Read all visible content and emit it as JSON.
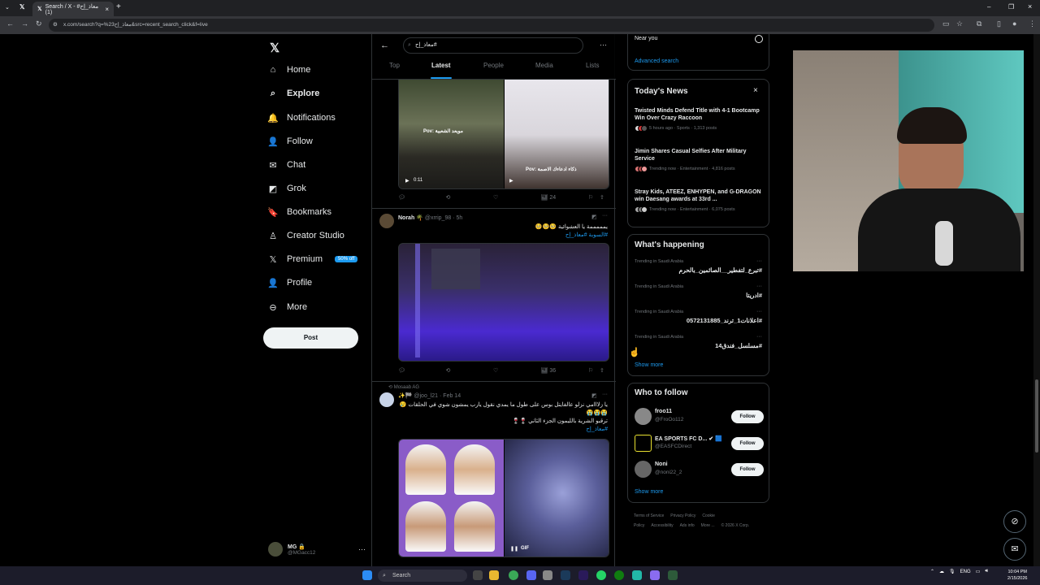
{
  "browser": {
    "tab_title": "Search / X - معاذ_إح# (1)",
    "url": "x.com/search?q=%23معاذ_إح&src=recent_search_click&f=live"
  },
  "sidebar": {
    "items": [
      {
        "label": "Home",
        "icon": "home-icon",
        "glyph": "⌂"
      },
      {
        "label": "Explore",
        "icon": "search-icon",
        "glyph": "⌕"
      },
      {
        "label": "Notifications",
        "icon": "bell-icon",
        "glyph": "🔔"
      },
      {
        "label": "Follow",
        "icon": "person-plus-icon",
        "glyph": "👤"
      },
      {
        "label": "Chat",
        "icon": "mail-icon",
        "glyph": "✉"
      },
      {
        "label": "Grok",
        "icon": "grok-icon",
        "glyph": "◩"
      },
      {
        "label": "Bookmarks",
        "icon": "bookmark-icon",
        "glyph": "🔖"
      },
      {
        "label": "Creator Studio",
        "icon": "creator-icon",
        "glyph": "♙"
      },
      {
        "label": "Premium",
        "icon": "x-premium-icon",
        "glyph": "𝕏"
      },
      {
        "label": "Profile",
        "icon": "profile-icon",
        "glyph": "👤"
      },
      {
        "label": "More",
        "icon": "more-circle-icon",
        "glyph": "⊖"
      }
    ],
    "premium_badge": "50% off",
    "post_button": "Post",
    "account": {
      "name": "MG 🔒",
      "handle": "@MGacc12"
    }
  },
  "search": {
    "query": "معاذ_إح#",
    "tabs": [
      "Top",
      "Latest",
      "People",
      "Media",
      "Lists"
    ],
    "active_tab": "Latest"
  },
  "feed": {
    "post0": {
      "video_time": "0:11",
      "caption_left": "Pov: مويعد الشعبية",
      "caption_right": "Pov: ذكاء ادعاءك الاصمة",
      "views": "24"
    },
    "post1": {
      "author": "Norah 🌴",
      "handle": "@xrrip_98 · 5h",
      "text": "يمممممة يا العشوائية 🥺🥺🥺",
      "hashtags": "#السوبة #معاذ_إح",
      "views": "36"
    },
    "post2": {
      "reposted_by": "Mosaab AG",
      "handle": "@joo_l21 · Feb 14",
      "emoji": "✨🏁",
      "text": "يا زلااامي نزلو عالفايتل بوس على طول ما يمدي نقول يارب يمشون شوي في الحلقات 😢",
      "text2": "😭😭😭",
      "text3": "ترقبو الشرية بالليمون الجزء الثاني 🍷🍷",
      "hashtags": "#معاذ_إح",
      "gif": "GIF"
    }
  },
  "right": {
    "near_you": "Near you",
    "advanced_search": "Advanced search",
    "todays_news": {
      "title": "Today's News",
      "items": [
        {
          "title": "Twisted Minds Defend Title with 4-1 Bootcamp Win Over Crazy Raccoon",
          "meta": "5 hours ago · Sports · 1,313 posts"
        },
        {
          "title": "Jimin Shares Casual Selfies After Military Service",
          "meta": "Trending now · Entertainment · 4,816 posts"
        },
        {
          "title": "Stray Kids, ATEEZ, ENHYPEN, and G-DRAGON win Daesang awards at 33rd ...",
          "meta": "Trending now · Entertainment · 6,075 posts"
        }
      ]
    },
    "whats_happening": {
      "title": "What's happening",
      "items": [
        {
          "category": "Trending in Saudi Arabia",
          "name": "#تبرع_لتفطير__الصائمين_بالحرم"
        },
        {
          "category": "Trending in Saudi Arabia",
          "name": "#ادريتا"
        },
        {
          "category": "Trending in Saudi Arabia",
          "name": "#اعلانات1_ترند_0572131885"
        },
        {
          "category": "Trending in Saudi Arabia",
          "name": "#مسلسل_فندق14"
        }
      ],
      "show_more": "Show more"
    },
    "who_to_follow": {
      "title": "Who to follow",
      "items": [
        {
          "name": "froo11",
          "handle": "@FroOo112",
          "button": "Follow"
        },
        {
          "name": "EA SPORTS FC D... ✔ 🟦",
          "handle": "@EASFCDirect",
          "button": "Follow"
        },
        {
          "name": "Noni",
          "handle": "@noni22_2",
          "button": "Follow"
        }
      ],
      "show_more": "Show more"
    },
    "footer": {
      "links": [
        "Terms of Service",
        "Privacy Policy",
        "Cookie Policy",
        "Accessibility",
        "Ads info",
        "More ...",
        "© 2026 X Corp."
      ]
    }
  },
  "taskbar": {
    "search": "Search",
    "lang": "ENG",
    "time": "10:04 PM",
    "date": "2/15/2026"
  },
  "colors": {
    "accent": "#1d9bf0",
    "bg": "#000000",
    "border": "#2f3336",
    "muted": "#71767b"
  }
}
